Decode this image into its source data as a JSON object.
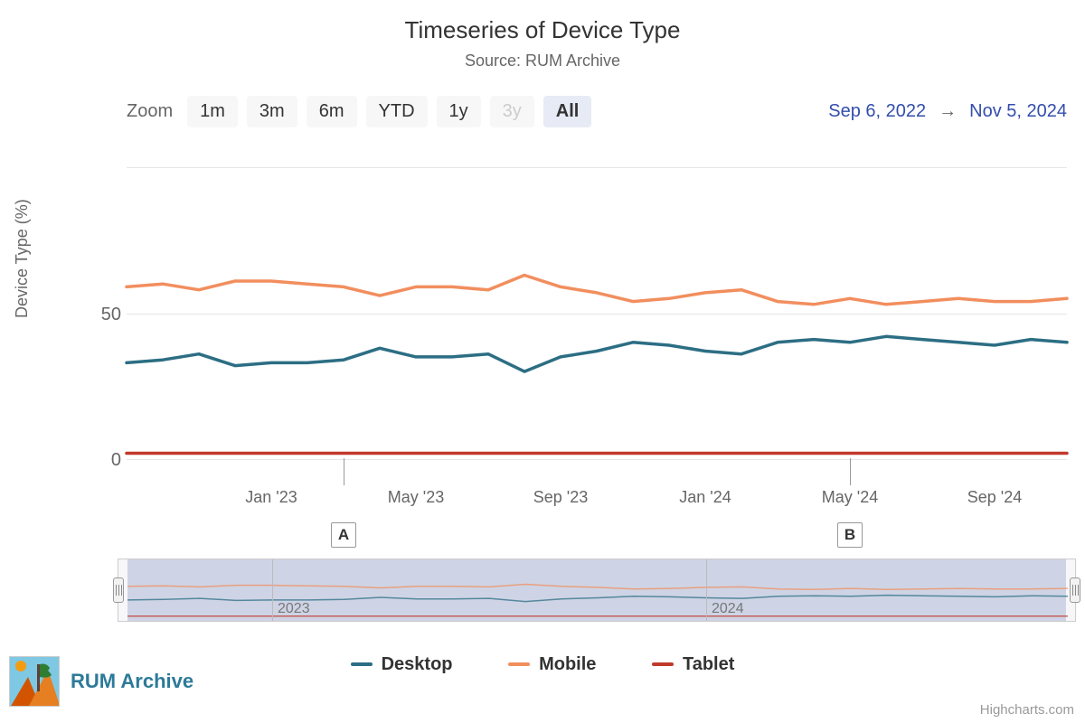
{
  "title": "Timeseries of Device Type",
  "subtitle": "Source: RUM Archive",
  "zoom": {
    "label": "Zoom",
    "buttons": [
      "1m",
      "3m",
      "6m",
      "YTD",
      "1y",
      "3y",
      "All"
    ],
    "disabled": "3y",
    "active": "All"
  },
  "range": {
    "from": "Sep 6, 2022",
    "to": "Nov 5, 2024",
    "arrow": "→"
  },
  "ylabel": "Device Type (%)",
  "yticks": [
    0,
    50
  ],
  "xticks": [
    "Jan '23",
    "May '23",
    "Sep '23",
    "Jan '24",
    "May '24",
    "Sep '24"
  ],
  "flags": {
    "A": "A",
    "B": "B"
  },
  "nav_years": [
    "2023",
    "2024"
  ],
  "legend": [
    "Desktop",
    "Mobile",
    "Tablet"
  ],
  "credits": "Highcharts.com",
  "logo_text": "RUM Archive",
  "colors": {
    "desktop": "#2c6e84",
    "mobile": "#f28e5e",
    "tablet": "#c0392b"
  },
  "chart_data": {
    "type": "line",
    "title": "Timeseries of Device Type",
    "xlabel": "",
    "ylabel": "Device Type (%)",
    "ylim": [
      0,
      100
    ],
    "x": [
      "2022-09",
      "2022-10",
      "2022-11",
      "2022-12",
      "2023-01",
      "2023-02",
      "2023-03",
      "2023-04",
      "2023-05",
      "2023-06",
      "2023-07",
      "2023-08",
      "2023-09",
      "2023-10",
      "2023-11",
      "2023-12",
      "2024-01",
      "2024-02",
      "2024-03",
      "2024-04",
      "2024-05",
      "2024-06",
      "2024-07",
      "2024-08",
      "2024-09",
      "2024-10",
      "2024-11"
    ],
    "series": [
      {
        "name": "Desktop",
        "color": "#2c6e84",
        "values": [
          33,
          34,
          36,
          32,
          33,
          33,
          34,
          38,
          35,
          35,
          36,
          30,
          35,
          37,
          40,
          39,
          37,
          36,
          40,
          41,
          40,
          42,
          41,
          40,
          39,
          41,
          40
        ]
      },
      {
        "name": "Mobile",
        "color": "#f28e5e",
        "values": [
          59,
          60,
          58,
          61,
          61,
          60,
          59,
          56,
          59,
          59,
          58,
          63,
          59,
          57,
          54,
          55,
          57,
          58,
          54,
          53,
          55,
          53,
          54,
          55,
          54,
          54,
          55
        ]
      },
      {
        "name": "Tablet",
        "color": "#c0392b",
        "values": [
          2,
          2,
          2,
          2,
          2,
          2,
          2,
          2,
          2,
          2,
          2,
          2,
          2,
          2,
          2,
          2,
          2,
          2,
          2,
          2,
          2,
          2,
          2,
          2,
          2,
          2,
          2
        ]
      }
    ],
    "annotations": [
      {
        "label": "A",
        "x": "2023-03"
      },
      {
        "label": "B",
        "x": "2024-05"
      }
    ]
  }
}
